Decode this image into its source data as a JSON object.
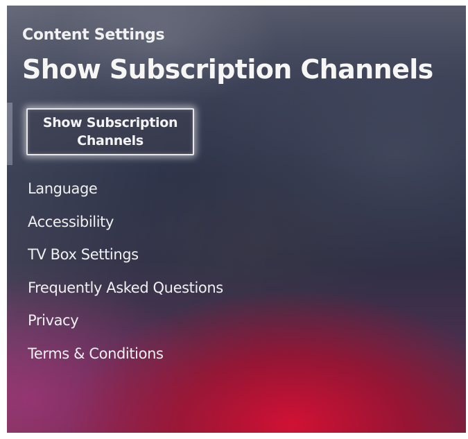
{
  "header": {
    "section_label": "Content Settings",
    "title": "Show Subscription Channels"
  },
  "selected_option": {
    "label": "Show Subscription Channels"
  },
  "menu": {
    "items": [
      {
        "label": "Language"
      },
      {
        "label": "Accessibility"
      },
      {
        "label": "TV Box Settings"
      },
      {
        "label": "Frequently Asked Questions"
      },
      {
        "label": "Privacy"
      },
      {
        "label": "Terms & Conditions"
      }
    ]
  },
  "colors": {
    "text": "#f2f2f2",
    "focus_border": "#e8e8e8",
    "brand_red": "#d61034"
  }
}
